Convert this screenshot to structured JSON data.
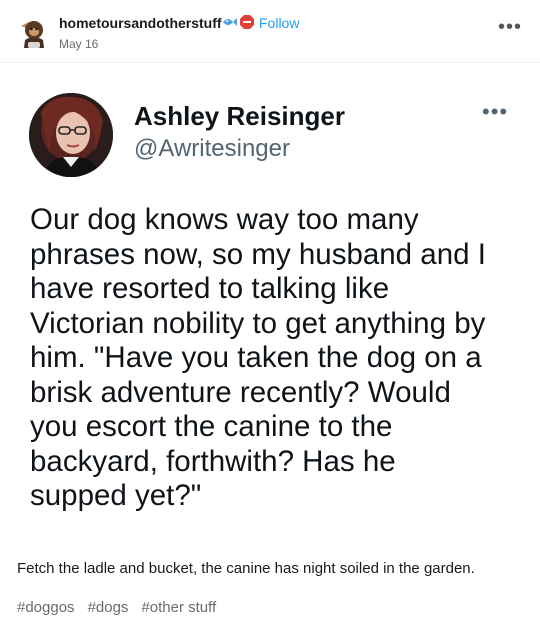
{
  "post": {
    "blog_name": "hometoursandotherstuff",
    "follow_label": "Follow",
    "date": "May 16",
    "more_icon": "more-horizontal-icon",
    "badge_colors": [
      "#4aa3df",
      "#e0403a"
    ]
  },
  "tweet": {
    "name": "Ashley Reisinger",
    "handle": "@Awritesinger",
    "text": "Our dog knows way too many\nphrases now, so my husband and I\nhave resorted to talking like\nVictorian nobility to get anything by\nhim. \"Have you taken the dog on a\nbrisk adventure recently? Would\nyou escort the canine to the\nbackyard, forthwith? Has he\nsupped yet?\""
  },
  "caption": "Fetch the ladle and bucket, the canine has night soiled in the garden.",
  "tags": [
    "#doggos",
    "#dogs",
    "#other stuff"
  ]
}
